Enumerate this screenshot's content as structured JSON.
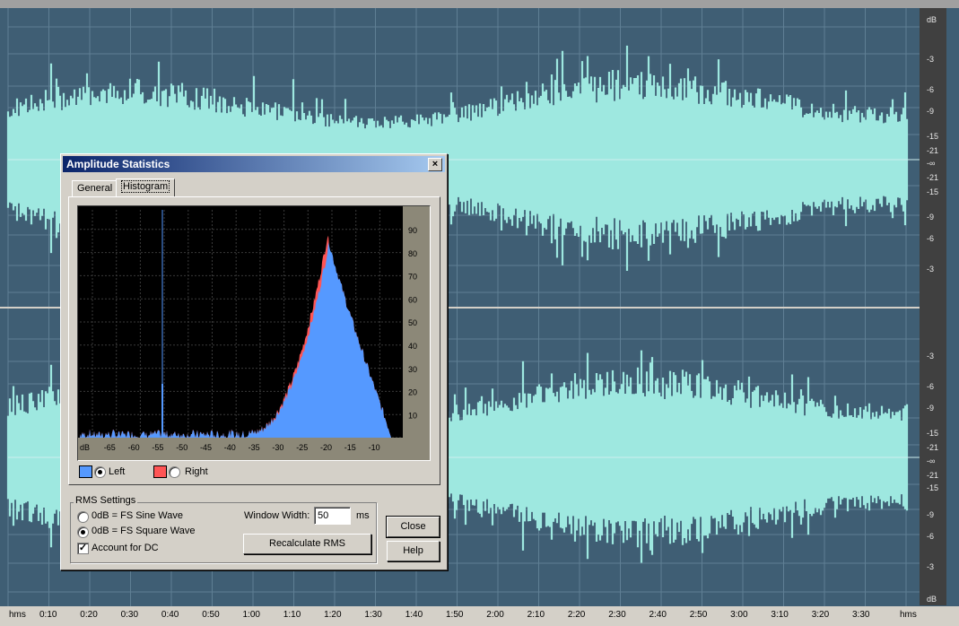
{
  "window": {
    "title": "Amplitude Statistics",
    "close_glyph": "×"
  },
  "tabs": [
    {
      "label": "General",
      "active": false
    },
    {
      "label": "Histogram",
      "active": true
    }
  ],
  "histogram": {
    "x_ticks": [
      "dB",
      "-65",
      "-60",
      "-55",
      "-50",
      "-45",
      "-40",
      "-35",
      "-30",
      "-25",
      "-20",
      "-15",
      "-10"
    ],
    "y_ticks": [
      "90",
      "80",
      "70",
      "60",
      "50",
      "40",
      "30",
      "20",
      "10"
    ],
    "left_color": "#5599ff",
    "right_color": "#ff5555"
  },
  "channels": {
    "left": {
      "label": "Left",
      "selected": true
    },
    "right": {
      "label": "Right",
      "selected": false
    }
  },
  "rms": {
    "group_title": "RMS Settings",
    "sine_label": "0dB = FS Sine Wave",
    "square_label": "0dB = FS Square Wave",
    "sine_selected": false,
    "square_selected": true,
    "dc_label": "Account for DC",
    "dc_checked": true,
    "window_width_label": "Window Width:",
    "window_width_value": "50",
    "window_width_unit": "ms",
    "recalc_label": "Recalculate RMS"
  },
  "buttons": {
    "close": "Close",
    "help": "Help"
  },
  "time_ruler": [
    "hms",
    "0:10",
    "0:20",
    "0:30",
    "0:40",
    "0:50",
    "1:00",
    "1:10",
    "1:20",
    "1:30",
    "1:40",
    "1:50",
    "2:00",
    "2:10",
    "2:20",
    "2:30",
    "2:40",
    "2:50",
    "3:00",
    "3:10",
    "3:20",
    "3:30",
    "hms"
  ],
  "db_scale_top": [
    "dB",
    "-3",
    "-6",
    "-9",
    "-15",
    "-21",
    "-∞",
    "-21",
    "-15",
    "-9",
    "-6",
    "-3"
  ],
  "db_scale_bottom": [
    "-3",
    "-6",
    "-9",
    "-15",
    "-21",
    "-∞",
    "-21",
    "-15",
    "-9",
    "-6",
    "-3",
    "dB"
  ],
  "colors": {
    "waveform": "#9ee8e0",
    "background": "#3f5e74"
  }
}
